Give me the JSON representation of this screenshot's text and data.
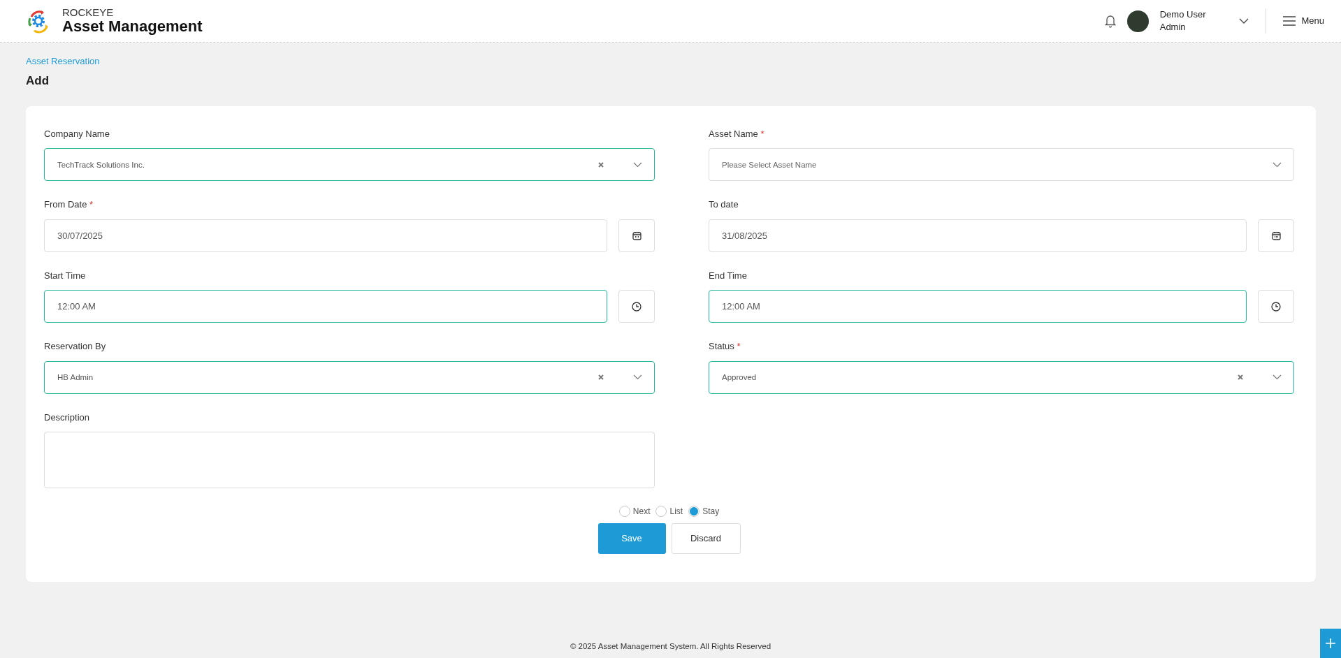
{
  "header": {
    "brand_top": "ROCKEYE",
    "brand_title": "Asset Management",
    "user_name": "Demo User",
    "user_role": "Admin",
    "menu_label": "Menu"
  },
  "breadcrumb": "Asset Reservation",
  "page_title": "Add",
  "fields": [
    {
      "kind": "select",
      "label": "Company Name",
      "value": "TechTrack Solutions Inc.",
      "valid": true,
      "clearable": true
    },
    {
      "kind": "select",
      "label": "Asset Name",
      "required_mark": "*",
      "placeholder": "Please Select Asset Name",
      "valid": false,
      "clearable": false
    },
    {
      "kind": "date",
      "label": "From Date",
      "required_mark": "*",
      "value": "30/07/2025",
      "valid": false
    },
    {
      "kind": "date",
      "label": "To date",
      "value": "31/08/2025",
      "valid": false
    },
    {
      "kind": "time",
      "label": "Start Time",
      "value": "12:00 AM",
      "valid": true
    },
    {
      "kind": "time",
      "label": "End Time",
      "value": "12:00 AM",
      "valid": true
    },
    {
      "kind": "select",
      "label": "Reservation By",
      "value": "HB Admin",
      "valid": true,
      "clearable": true
    },
    {
      "kind": "select",
      "label": "Status",
      "required_mark": "*",
      "value": "Approved",
      "valid": true,
      "clearable": true
    },
    {
      "kind": "textarea",
      "label": "Description",
      "valid": false
    }
  ],
  "after_save": [
    {
      "label": "Next",
      "selected": false
    },
    {
      "label": "List",
      "selected": false
    },
    {
      "label": "Stay",
      "selected": true
    }
  ],
  "buttons": [
    {
      "label": "Save",
      "kind": "primary"
    },
    {
      "label": "Discard",
      "kind": "secondary"
    }
  ],
  "footer": "© 2025 Asset Management System. All Rights Reserved"
}
